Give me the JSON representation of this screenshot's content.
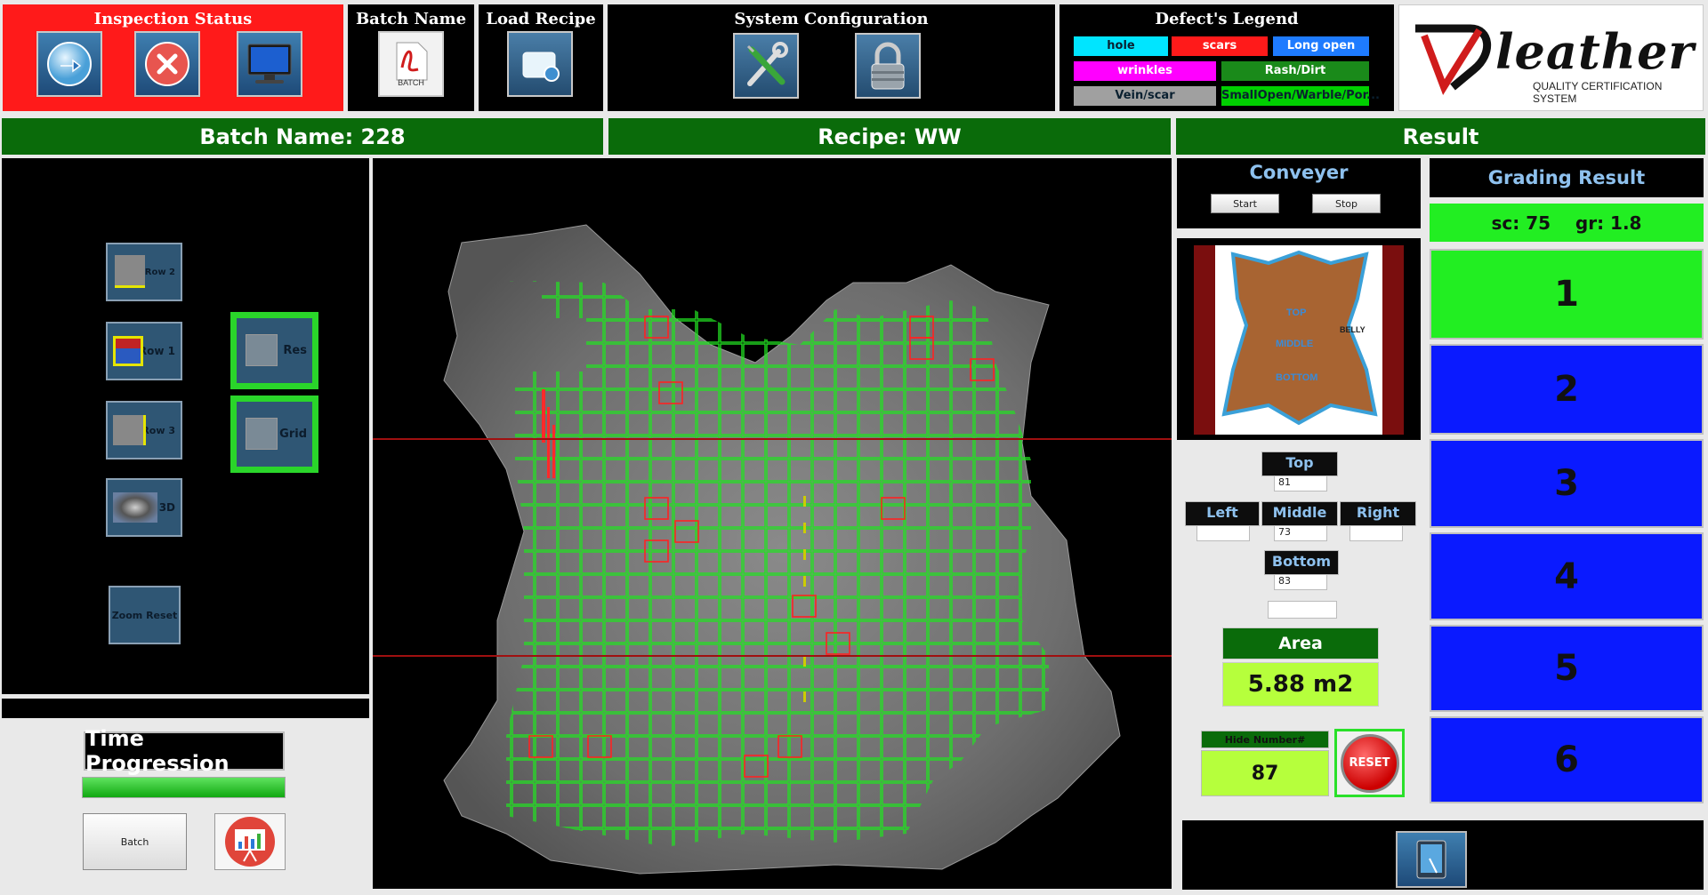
{
  "toolbar": {
    "inspection_status": "Inspection Status",
    "batch_name": "Batch Name",
    "batch_icon_label": "BATCH",
    "load_recipe": "Load Recipe",
    "system_configuration": "System Configuration",
    "legend_title": "Defect's Legend"
  },
  "legend": [
    {
      "label": "hole",
      "color": "#00e5ff"
    },
    {
      "label": "scars",
      "color": "#ff1a1a"
    },
    {
      "label": "Long open",
      "color": "#1e7bff"
    },
    {
      "label": "wrinkles",
      "color": "#ff00ff"
    },
    {
      "label": "Rash/Dirt",
      "color": "#1a8a1a"
    },
    {
      "label": "Vein/scar",
      "color": "#a0a0a0"
    },
    {
      "label": "SmallOpen/Warble/Por...",
      "color": "#00d000"
    }
  ],
  "logo": {
    "main": "leather",
    "sub": "QUALITY CERTIFICATION SYSTEM"
  },
  "header": {
    "batch": "Batch Name: 228",
    "recipe": "Recipe: WW",
    "result": "Result"
  },
  "left_panel": {
    "row2": "Row 2",
    "row1": "Row 1",
    "row3": "Row 3",
    "three_d": "3D",
    "zoom_reset": "Zoom Reset",
    "res": "Res",
    "grid": "Grid"
  },
  "time_progression": {
    "title": "Time Progression",
    "progress": 1.0
  },
  "bottom_left": {
    "batch_button": "Batch"
  },
  "conveyer": {
    "title": "Conveyer",
    "start": "Start",
    "stop": "Stop"
  },
  "hide_diagram": {
    "top": "TOP",
    "middle": "MIDDLE",
    "bottom": "BOTTOM",
    "belly": "BELLY"
  },
  "zones": {
    "top_label": "Top",
    "top_value": "81",
    "left_label": "Left",
    "left_value": "",
    "middle_label": "Middle",
    "middle_value": "73",
    "right_label": "Right",
    "right_value": "",
    "bottom_label": "Bottom",
    "bottom_value": "83"
  },
  "area": {
    "label": "Area",
    "value": "5.88 m2"
  },
  "hide_number": {
    "label": "Hide Number#",
    "value": "87"
  },
  "reset_button": "RESET",
  "grading": {
    "title": "Grading Result",
    "score": "sc: 75    gr: 1.8",
    "grades": [
      "1",
      "2",
      "3",
      "4",
      "5",
      "6"
    ],
    "active_grade": "1",
    "active_color": "#22ee22",
    "inactive_color": "#0a1aff"
  }
}
